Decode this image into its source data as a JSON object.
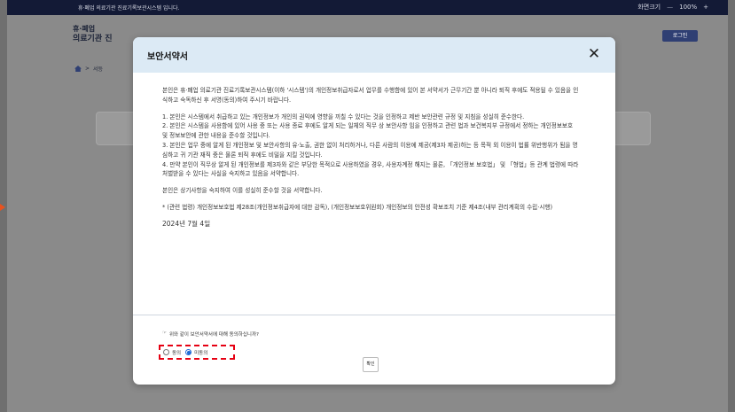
{
  "topbar": {
    "notice": "휴·폐업 의료기관 진료기록보관시스템 입니다.",
    "zoom_label": "화면크기",
    "zoom_out": "—",
    "zoom_value": "100%",
    "zoom_in": "+"
  },
  "background": {
    "line1": "휴·폐업",
    "line2": "의료기관 진",
    "login_label": "로그인",
    "breadcrumb": ">",
    "breadcrumb_text": "서등"
  },
  "modal": {
    "title": "보안서약서",
    "close_glyph": "✕",
    "paragraphs": [
      "본인은 휴·폐업 의료기관 진료기록보관시스템(이하 '시스템')의 개인정보취급자로서 업무를 수행함에 있어 본 서약서가 근무기간 뿐 아니라 퇴직 후에도 적용될 수 있음을 인식하고 숙독하신 후 서명(동의)하여 주시기 바랍니다.",
      "1. 본인은 시스템에서 취급하고 있는 개인정보가 개인의 권익에 영향을 끼칠 수 있다는 것을 인정하고 제반 보안관련 규정 및 지침을 성실히 준수한다.\n2. 본인은 시스템을 사용함에 있어 사용 중 또는 사용 종료 후에도 알게 되는 일체의 직무 상 보안사항 임을 인정하고 관련 법과 보건복지부 규정에서 정하는 개인정보보호 및 정보보안에 관한 내용을 준수할 것입니다.\n3. 본인은 업무 중에 알게 된 개인정보 및 보안사항의 유·노출, 권한 없이 처리하거나, 다른 사람의 이용에 제공(제3자 제공)하는 등 목적 외 이용이 법률 위반행위가 됨을 명심하고 귀 기관 재직 중은 물론 퇴직 후에도 비밀을 지킬 것입니다.\n4. 만약 본인이 직무상 알게 된 개인정보를 제3자와 같은 부당한 목적으로 사용하였을 경우, 사용자계정 해지는 물론, 「개인정보 보호법」 및 「형법」등 관계 법령에 따라 처벌받을 수 있다는 사실을 숙지하고 있음을 서약합니다.",
      "본인은 상기사항을 숙지하여 이를 성실히 준수할 것을 서약합니다.",
      "* (관련 법령) 개인정보보호법 제28조(개인정보취급자에 대한 감독), (개인정보보호위원회) 개인정보의 안전성 확보조치 기준 제4조(내부 관리계획의 수립·시행)"
    ],
    "date": "2024년 7월 4일",
    "question_icon": "☞",
    "question": "위와 같이 보안서약서에 대해 동의하십니까?",
    "options": [
      {
        "label": "동의",
        "selected": false
      },
      {
        "label": "미동의",
        "selected": true
      }
    ],
    "confirm_label": "확인"
  },
  "colors": {
    "topbar": "#131a36",
    "modal_header": "#dceaf5",
    "highlight": "#e60012",
    "radio_selected": "#1f6bd6"
  }
}
